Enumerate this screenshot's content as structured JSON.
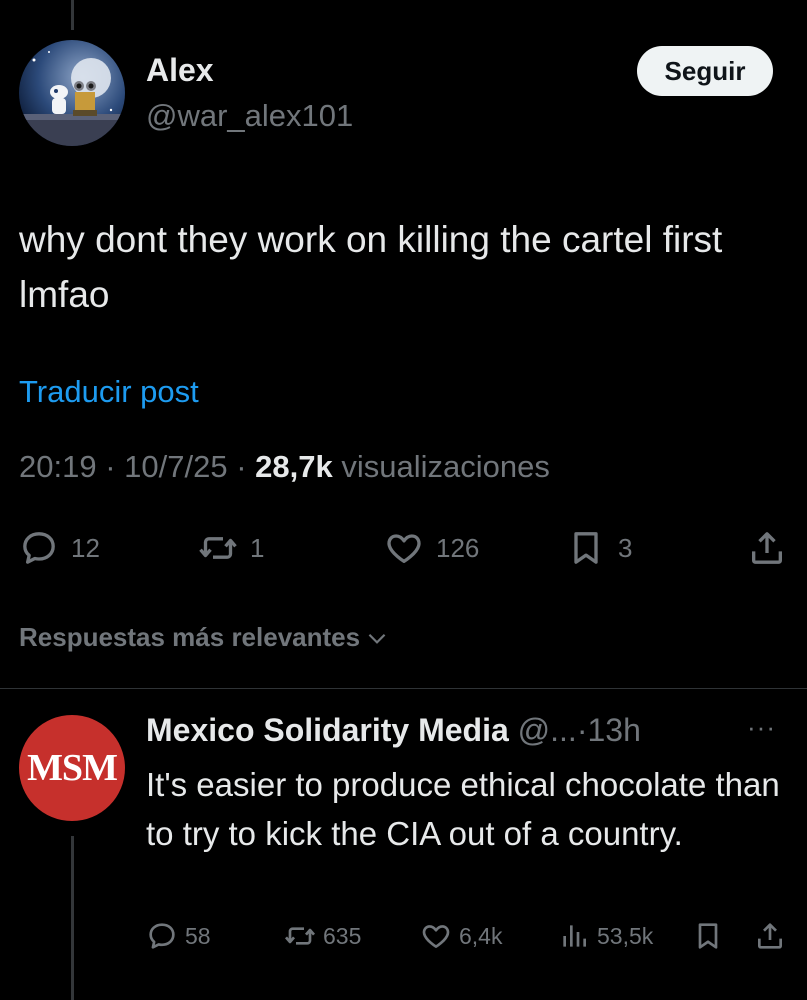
{
  "post": {
    "author_name": "Alex",
    "author_handle": "@war_alex101",
    "follow_label": "Seguir",
    "text": "why dont they work on killing the cartel first lmfao",
    "translate_label": "Traducir post",
    "time": "20:19",
    "sep1": "·",
    "date": "10/7/25",
    "sep2": "·",
    "views_count": "28,7k",
    "views_label": "visualizaciones",
    "replies": "12",
    "reposts": "1",
    "likes": "126",
    "bookmarks": "3"
  },
  "sort_label": "Respuestas más relevantes",
  "reply": {
    "avatar_text": "MSM",
    "author_name": "Mexico Solidarity Media",
    "author_handle": "@...",
    "dot": "·",
    "time": "13h",
    "more": "···",
    "text": "It's easier to produce ethical chocolate than to try to kick the CIA out of a country.",
    "replies": "58",
    "reposts": "635",
    "likes": "6,4k",
    "views": "53,5k"
  },
  "icons": [
    "comment-icon",
    "repost-icon",
    "heart-icon",
    "bookmark-icon",
    "share-icon",
    "views-icon",
    "more-icon",
    "chevron-down-icon"
  ],
  "colors": {
    "background": "#000000",
    "text": "#e7e9ea",
    "muted": "#71767b",
    "link": "#1d9bf0",
    "msm_red": "#c6302c"
  }
}
